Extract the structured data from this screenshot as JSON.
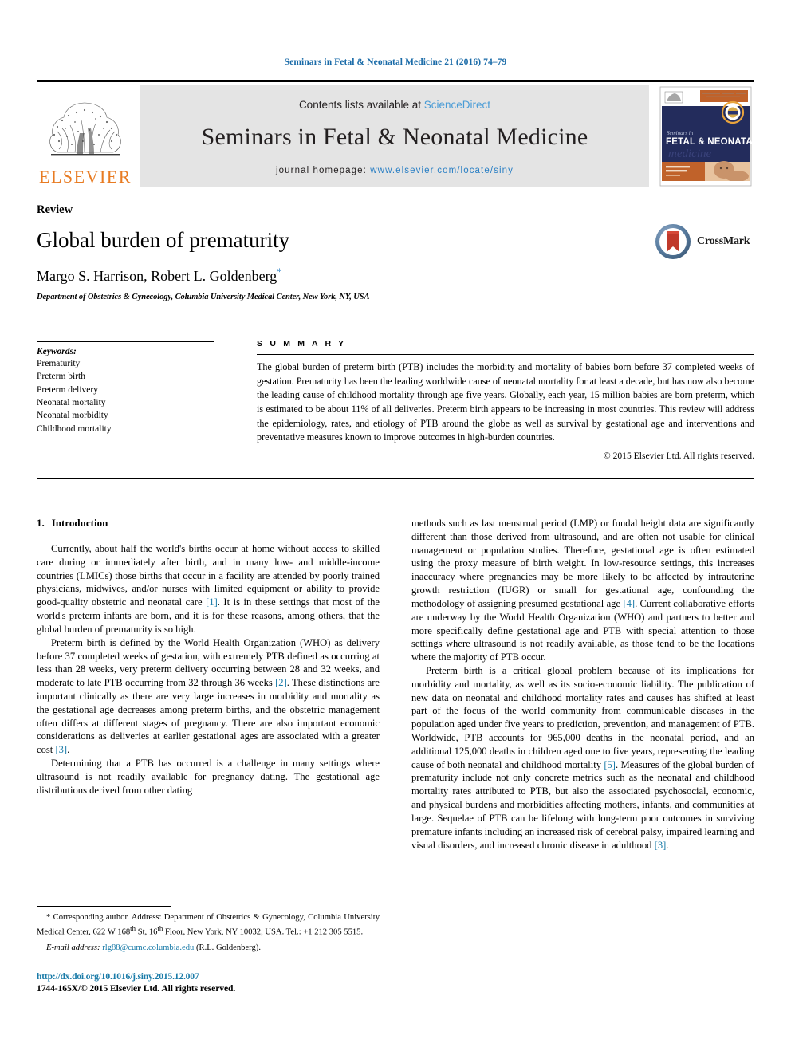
{
  "running_head": "Seminars in Fetal & Neonatal Medicine 21 (2016) 74–79",
  "masthead": {
    "contents_prefix": "Contents lists available at ",
    "sciencedirect": "ScienceDirect",
    "journal_title": "Seminars in Fetal & Neonatal Medicine",
    "homepage_prefix": "journal homepage: ",
    "homepage_url": "www.elsevier.com/locate/siny",
    "publisher_logo_text": "ELSEVIER",
    "publisher_logo_icon": "elsevier-tree-icon",
    "cover_icon": "journal-cover-thumbnail",
    "cover_title_line1": "Seminars in",
    "cover_title_line2": "FETAL & NEONATAL",
    "cover_title_line3": "medicine"
  },
  "article": {
    "type": "Review",
    "title": "Global burden of prematurity",
    "authors": "Margo S. Harrison, Robert L. Goldenberg",
    "corresponding_marker": "*",
    "affiliation": "Department of Obstetrics & Gynecology, Columbia University Medical Center, New York, NY, USA",
    "crossmark_label": "CrossMark"
  },
  "keywords": {
    "label": "Keywords:",
    "items": [
      "Prematurity",
      "Preterm birth",
      "Preterm delivery",
      "Neonatal mortality",
      "Neonatal morbidity",
      "Childhood mortality"
    ]
  },
  "summary": {
    "label": "S U M M A R Y",
    "text": "The global burden of preterm birth (PTB) includes the morbidity and mortality of babies born before 37 completed weeks of gestation. Prematurity has been the leading worldwide cause of neonatal mortality for at least a decade, but has now also become the leading cause of childhood mortality through age five years. Globally, each year, 15 million babies are born preterm, which is estimated to be about 11% of all deliveries. Preterm birth appears to be increasing in most countries. This review will address the epidemiology, rates, and etiology of PTB around the globe as well as survival by gestational age and interventions and preventative measures known to improve outcomes in high-burden countries.",
    "copyright": "© 2015 Elsevier Ltd. All rights reserved."
  },
  "sections": {
    "intro_number": "1.",
    "intro_title": "Introduction"
  },
  "body": {
    "left": [
      "Currently, about half the world's births occur at home without access to skilled care during or immediately after birth, and in many low- and middle-income countries (LMICs) those births that occur in a facility are attended by poorly trained physicians, midwives, and/or nurses with limited equipment or ability to provide good-quality obstetric and neonatal care [1]. It is in these settings that most of the world's preterm infants are born, and it is for these reasons, among others, that the global burden of prematurity is so high.",
      "Preterm birth is defined by the World Health Organization (WHO) as delivery before 37 completed weeks of gestation, with extremely PTB defined as occurring at less than 28 weeks, very preterm delivery occurring between 28 and 32 weeks, and moderate to late PTB occurring from 32 through 36 weeks [2]. These distinctions are important clinically as there are very large increases in morbidity and mortality as the gestational age decreases among preterm births, and the obstetric management often differs at different stages of pregnancy. There are also important economic considerations as deliveries at earlier gestational ages are associated with a greater cost [3].",
      "Determining that a PTB has occurred is a challenge in many settings where ultrasound is not readily available for pregnancy dating. The gestational age distributions derived from other dating"
    ],
    "right": [
      "methods such as last menstrual period (LMP) or fundal height data are significantly different than those derived from ultrasound, and are often not usable for clinical management or population studies. Therefore, gestational age is often estimated using the proxy measure of birth weight. In low-resource settings, this increases inaccuracy where pregnancies may be more likely to be affected by intrauterine growth restriction (IUGR) or small for gestational age, confounding the methodology of assigning presumed gestational age [4]. Current collaborative efforts are underway by the World Health Organization (WHO) and partners to better and more specifically define gestational age and PTB with special attention to those settings where ultrasound is not readily available, as those tend to be the locations where the majority of PTB occur.",
      "Preterm birth is a critical global problem because of its implications for morbidity and mortality, as well as its socio-economic liability. The publication of new data on neonatal and childhood mortality rates and causes has shifted at least part of the focus of the world community from communicable diseases in the population aged under five years to prediction, prevention, and management of PTB. Worldwide, PTB accounts for 965,000 deaths in the neonatal period, and an additional 125,000 deaths in children aged one to five years, representing the leading cause of both neonatal and childhood mortality [5]. Measures of the global burden of prematurity include not only concrete metrics such as the neonatal and childhood mortality rates attributed to PTB, but also the associated psychosocial, economic, and physical burdens and morbidities affecting mothers, infants, and communities at large. Sequelae of PTB can be lifelong with long-term poor outcomes in surviving premature infants including an increased risk of cerebral palsy, impaired learning and visual disorders, and increased chronic disease in adulthood [3]."
    ]
  },
  "footnote": {
    "corresponding": "* Corresponding author. Address: Department of Obstetrics & Gynecology, Columbia University Medical Center, 622 W 168th St, 16th Floor, New York, NY 10032, USA. Tel.: +1 212 305 5515.",
    "email_label": "E-mail address:",
    "email": "rlg88@cumc.columbia.edu",
    "email_owner": "(R.L. Goldenberg)."
  },
  "footer": {
    "doi": "http://dx.doi.org/10.1016/j.siny.2015.12.007",
    "issn_copyright": "1744-165X/© 2015 Elsevier Ltd. All rights reserved."
  },
  "colors": {
    "link": "#1a7ba8",
    "sciencedirect": "#4a9cd6",
    "elsevier_orange": "#E87B22",
    "masthead_grey": "#e4e4e4",
    "cover_navy": "#232c5c"
  }
}
